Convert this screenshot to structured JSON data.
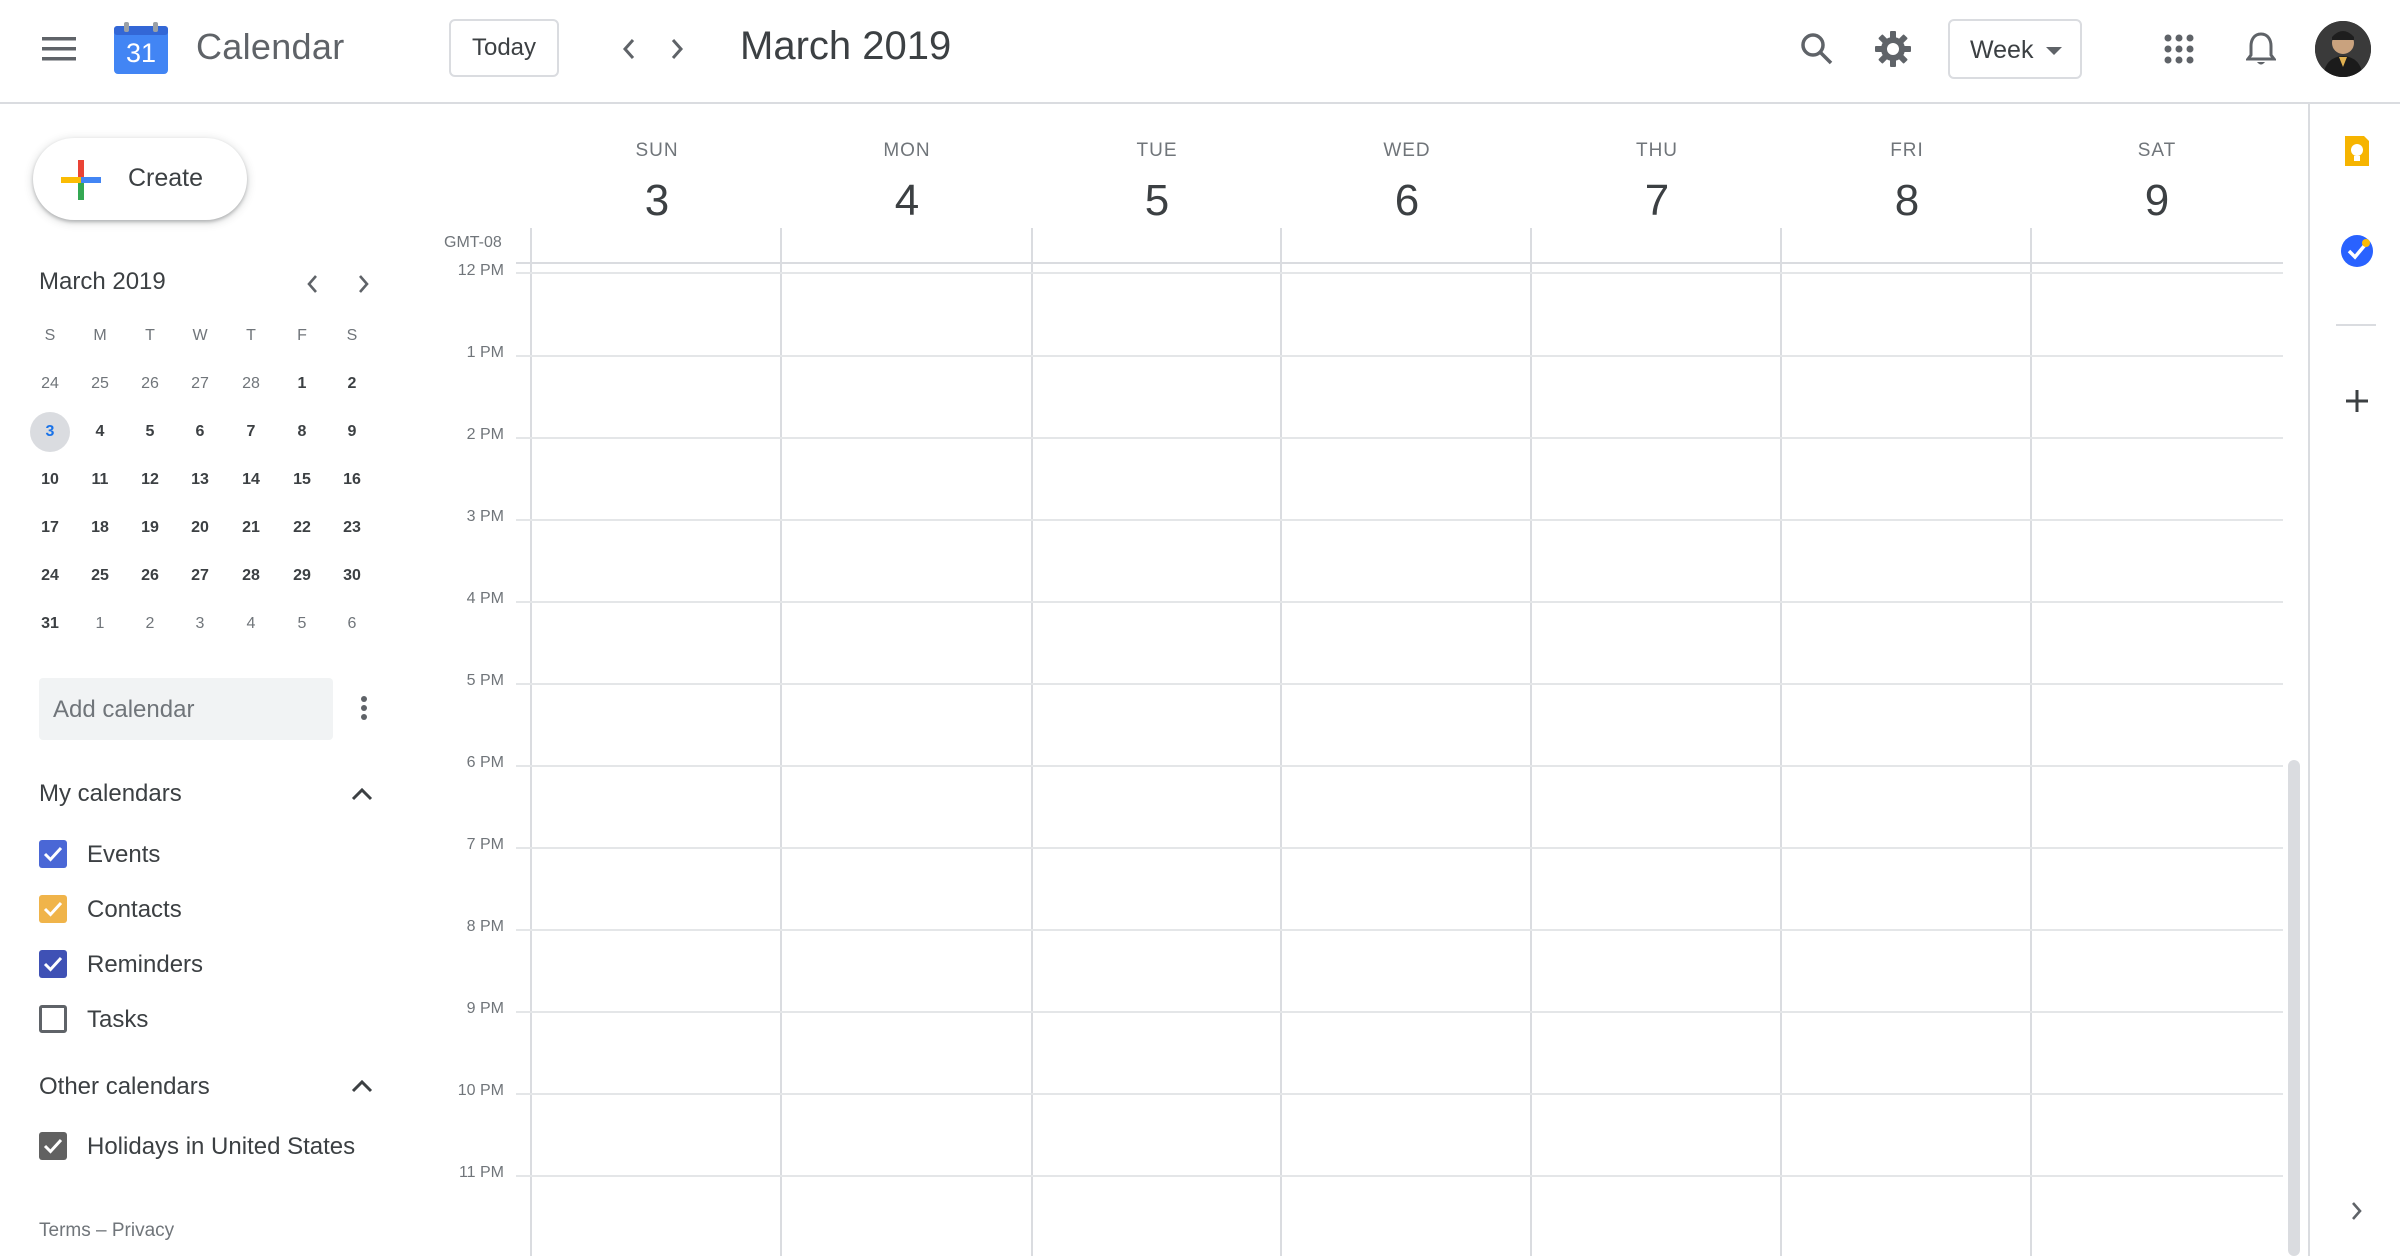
{
  "app": {
    "name": "Calendar",
    "logo_day": "31"
  },
  "header": {
    "today_label": "Today",
    "period": "March 2019",
    "view": "Week"
  },
  "sidebar": {
    "create_label": "Create",
    "mini_month": "March 2019",
    "dow": [
      "S",
      "M",
      "T",
      "W",
      "T",
      "F",
      "S"
    ],
    "weeks": [
      [
        "24",
        "25",
        "26",
        "27",
        "28",
        "1",
        "2"
      ],
      [
        "3",
        "4",
        "5",
        "6",
        "7",
        "8",
        "9"
      ],
      [
        "10",
        "11",
        "12",
        "13",
        "14",
        "15",
        "16"
      ],
      [
        "17",
        "18",
        "19",
        "20",
        "21",
        "22",
        "23"
      ],
      [
        "24",
        "25",
        "26",
        "27",
        "28",
        "29",
        "30"
      ],
      [
        "31",
        "1",
        "2",
        "3",
        "4",
        "5",
        "6"
      ]
    ],
    "add_calendar_placeholder": "Add calendar",
    "my_calendars_title": "My calendars",
    "my_calendars": [
      {
        "label": "Events",
        "checked": true,
        "color": "#4a67d6"
      },
      {
        "label": "Contacts",
        "checked": true,
        "color": "#f0b44a"
      },
      {
        "label": "Reminders",
        "checked": true,
        "color": "#3f51b5"
      },
      {
        "label": "Tasks",
        "checked": false,
        "color": "#5f6368"
      }
    ],
    "other_calendars_title": "Other calendars",
    "other_calendars": [
      {
        "label": "Holidays in United States",
        "checked": true,
        "color": "#616161"
      }
    ],
    "footer": {
      "terms": "Terms",
      "separator": "–",
      "privacy": "Privacy"
    }
  },
  "week": {
    "timezone": "GMT-08",
    "days": [
      {
        "dow": "SUN",
        "num": "3"
      },
      {
        "dow": "MON",
        "num": "4"
      },
      {
        "dow": "TUE",
        "num": "5"
      },
      {
        "dow": "WED",
        "num": "6"
      },
      {
        "dow": "THU",
        "num": "7"
      },
      {
        "dow": "FRI",
        "num": "8"
      },
      {
        "dow": "SAT",
        "num": "9"
      }
    ],
    "hours": [
      "12 PM",
      "1 PM",
      "2 PM",
      "3 PM",
      "4 PM",
      "5 PM",
      "6 PM",
      "7 PM",
      "8 PM",
      "9 PM",
      "10 PM",
      "11 PM"
    ]
  },
  "icons": {
    "menu": "menu-icon",
    "prev": "chevron-left-icon",
    "next": "chevron-right-icon",
    "search": "search-icon",
    "settings": "gear-icon",
    "apps": "apps-grid-icon",
    "notifications": "bell-icon",
    "keep": "keep-bulb-icon",
    "tasks": "tasks-check-icon",
    "add": "plus-icon",
    "expand": "chevron-right-icon"
  },
  "colors": {
    "accent": "#1a73e8",
    "keep": "#f6b400",
    "tasks": "#2962ff",
    "today_bg": "#dadce0"
  }
}
